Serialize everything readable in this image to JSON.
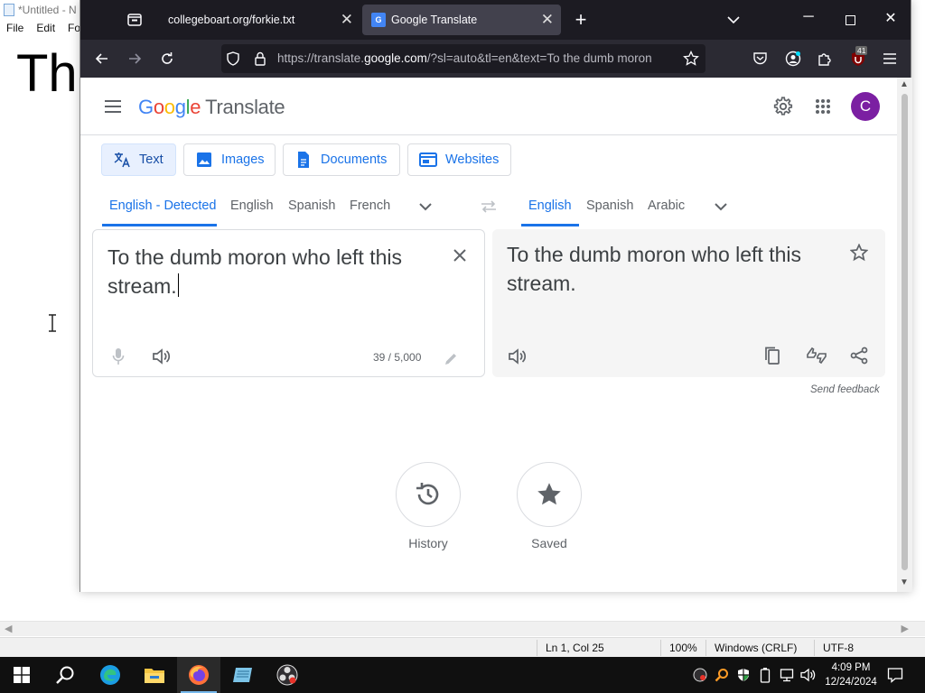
{
  "notepad": {
    "title": "*Untitled - N",
    "menu": [
      "File",
      "Edit",
      "Fo"
    ],
    "content_visible": "Th",
    "status": {
      "position": "Ln 1, Col 25",
      "zoom": "100%",
      "line_ending": "Windows (CRLF)",
      "encoding": "UTF-8"
    }
  },
  "browser": {
    "tabs": [
      {
        "title": "collegeboart.org/forkie.txt",
        "active": false
      },
      {
        "title": "Google Translate",
        "active": true
      }
    ],
    "url_prefix": "https://translate.",
    "url_domain": "google.com",
    "url_rest": "/?sl=auto&tl=en&text=To the dumb moron",
    "badge_count": "41"
  },
  "translate": {
    "logo_letters": [
      {
        "ch": "G",
        "color": "#4285f4"
      },
      {
        "ch": "o",
        "color": "#ea4335"
      },
      {
        "ch": "o",
        "color": "#fbbc04"
      },
      {
        "ch": "g",
        "color": "#4285f4"
      },
      {
        "ch": "l",
        "color": "#34a853"
      },
      {
        "ch": "e",
        "color": "#ea4335"
      }
    ],
    "product": "Translate",
    "avatar_letter": "C",
    "modes": [
      "Text",
      "Images",
      "Documents",
      "Websites"
    ],
    "source_langs": [
      "English - Detected",
      "English",
      "Spanish",
      "French"
    ],
    "target_langs": [
      "English",
      "Spanish",
      "Arabic"
    ],
    "source_text": "To the dumb moron who left this stream.",
    "char_count": "39 / 5,000",
    "translated_text": "To the dumb moron who left this stream.",
    "send_feedback": "Send feedback",
    "history_label": "History",
    "saved_label": "Saved"
  },
  "taskbar": {
    "time": "4:09 PM",
    "date": "12/24/2024"
  },
  "colors": {
    "accent": "#1a73e8",
    "tabbar": "#1c1b22",
    "navbar": "#2b2a33",
    "avatar": "#7b1fa2"
  }
}
